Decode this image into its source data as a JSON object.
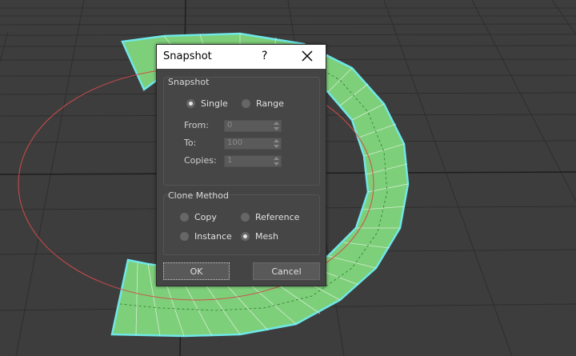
{
  "dialog": {
    "title": "Snapshot",
    "help_label": "?",
    "groups": {
      "snapshot": {
        "label": "Snapshot",
        "options": [
          {
            "label": "Single",
            "selected": true
          },
          {
            "label": "Range",
            "selected": false
          }
        ],
        "fields": [
          {
            "label": "From:",
            "value": "0"
          },
          {
            "label": "To:",
            "value": "100"
          },
          {
            "label": "Copies:",
            "value": "1"
          }
        ]
      },
      "clone_method": {
        "label": "Clone Method",
        "options": [
          {
            "label": "Copy",
            "selected": false
          },
          {
            "label": "Reference",
            "selected": false
          },
          {
            "label": "Instance",
            "selected": false
          },
          {
            "label": "Mesh",
            "selected": true
          }
        ]
      }
    },
    "buttons": {
      "ok": "OK",
      "cancel": "Cancel"
    }
  },
  "colors": {
    "viewport_bg": "#3d3d3d",
    "grid": "#2a2a2a",
    "mesh_fill": "#7ecf7a",
    "mesh_outline": "#6fe8e8",
    "circle": "#d24a4a"
  }
}
